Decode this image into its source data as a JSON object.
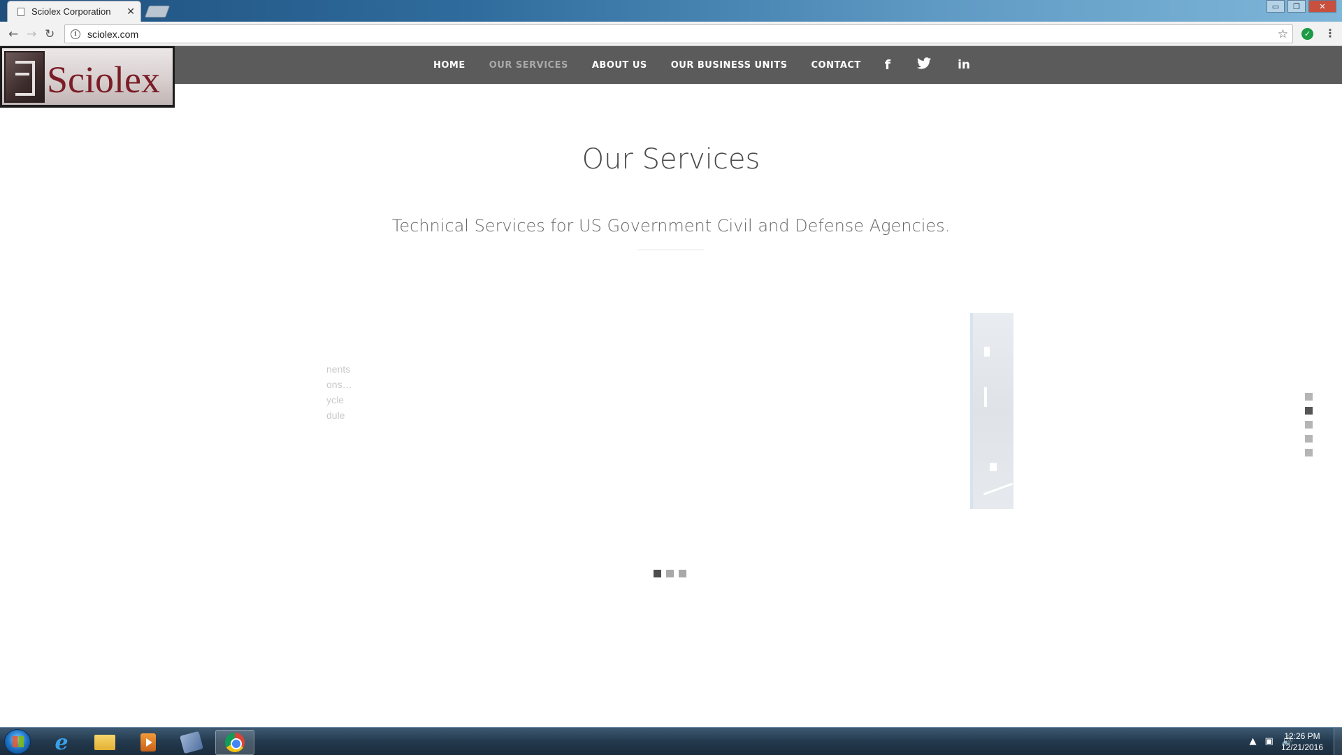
{
  "browser": {
    "tab_title": "Sciolex Corporation",
    "tab_close": "✕",
    "url": "sciolex.com",
    "back": "←",
    "forward": "→",
    "reload": "↻",
    "info_icon": "i",
    "star": "☆",
    "extension_check": "✓",
    "menu": "⋮",
    "window_controls": {
      "minimize": "▭",
      "restore": "❐",
      "close": "✕"
    }
  },
  "site": {
    "logo_text": "Sciolex",
    "nav": [
      {
        "label": "HOME",
        "active": false
      },
      {
        "label": "OUR SERVICES",
        "active": true
      },
      {
        "label": "ABOUT US",
        "active": false
      },
      {
        "label": "OUR BUSINESS UNITS",
        "active": false
      },
      {
        "label": "CONTACT",
        "active": false
      }
    ],
    "social": {
      "facebook": "f",
      "twitter": "🐦",
      "linkedin": "in"
    }
  },
  "main": {
    "title": "Our Services",
    "subtitle": "Technical Services for US Government Civil and Defense Agencies.",
    "faded_text": [
      "nents",
      "ons…",
      "ycle",
      "dule"
    ],
    "carousel": {
      "count": 3,
      "active_index": 0
    },
    "section_nav": {
      "count": 5,
      "active_index": 1
    }
  },
  "taskbar": {
    "time": "12:26 PM",
    "date": "12/21/2016",
    "tray_arrow": "▲",
    "active_app": "chrome"
  },
  "colors": {
    "nav_bg": "#5b5b5b",
    "nav_active": "#a9a9a9",
    "logo_text": "#7a1d26",
    "title_text": "#4a4a4a"
  }
}
